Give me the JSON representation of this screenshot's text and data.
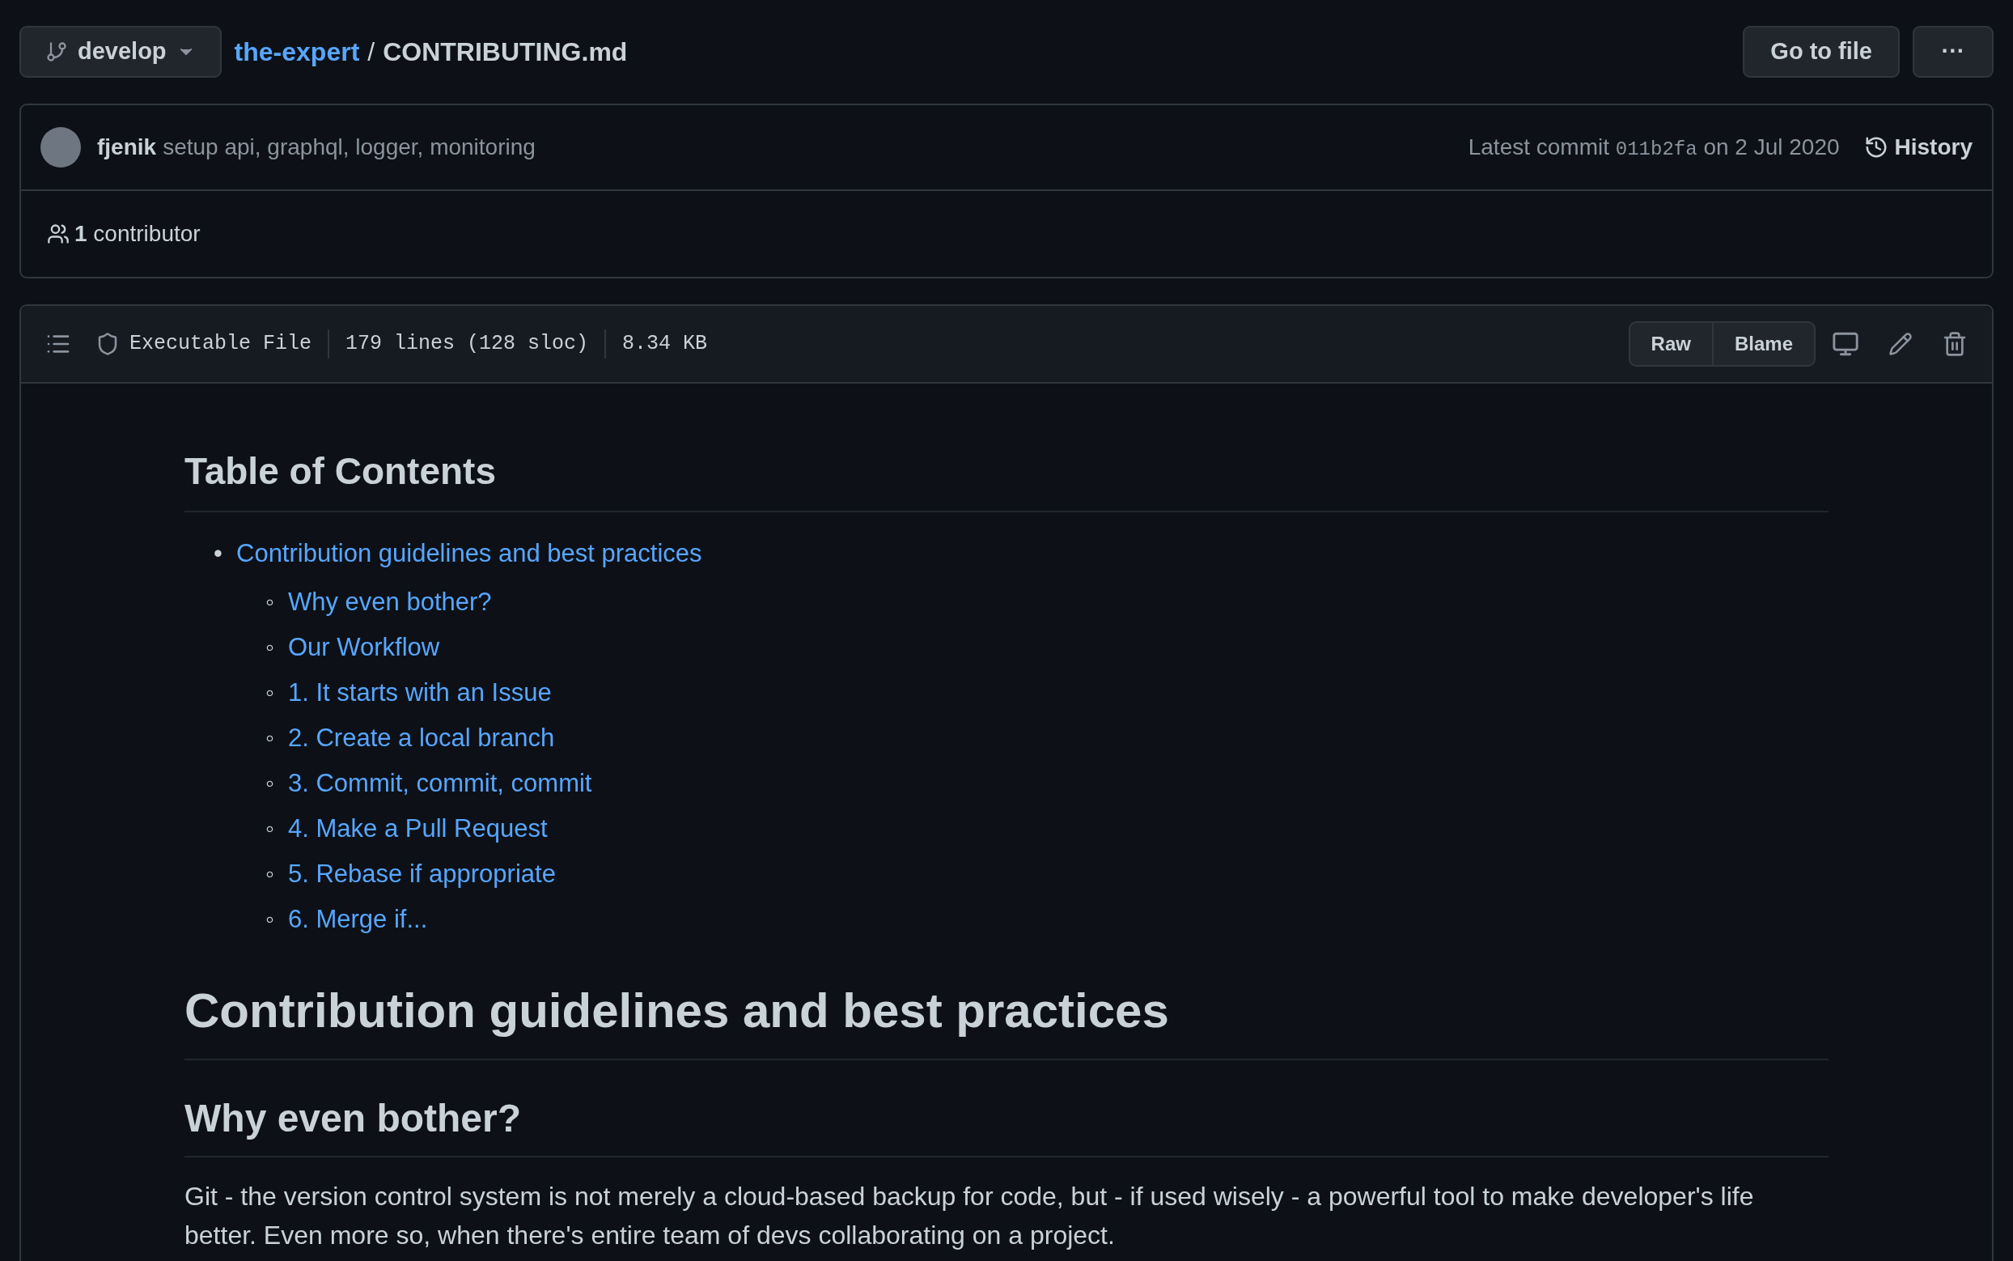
{
  "branch": {
    "name": "develop"
  },
  "breadcrumb": {
    "repo": "the-expert",
    "separator": "/",
    "file": "CONTRIBUTING.md"
  },
  "actions": {
    "go_to_file": "Go to file",
    "more": "···"
  },
  "commit": {
    "author": "fjenik",
    "message": "setup api, graphql, logger, monitoring",
    "prefix": "Latest commit",
    "sha": "011b2fa",
    "date": "on 2 Jul 2020",
    "history": "History"
  },
  "contributors": {
    "count": "1",
    "label": "contributor"
  },
  "file_header": {
    "type": "Executable File",
    "lines": "179 lines (128 sloc)",
    "size": "8.34 KB",
    "buttons": [
      "Raw",
      "Blame"
    ]
  },
  "content": {
    "toc_title": "Table of Contents",
    "toc": [
      {
        "marker": "•",
        "label": "Contribution guidelines and best practices",
        "children": [
          {
            "marker": "◦",
            "label": "Why even bother?"
          },
          {
            "marker": "◦",
            "label": "Our Workflow"
          },
          {
            "marker": "◦",
            "label": "1. It starts with an Issue"
          },
          {
            "marker": "◦",
            "label": "2. Create a local branch"
          },
          {
            "marker": "◦",
            "label": "3. Commit, commit, commit"
          },
          {
            "marker": "◦",
            "label": "4. Make a Pull Request"
          },
          {
            "marker": "◦",
            "label": "5. Rebase if appropriate"
          },
          {
            "marker": "◦",
            "label": "6. Merge if..."
          }
        ]
      }
    ],
    "h1": "Contribution guidelines and best practices",
    "h2": "Why even bother?",
    "paragraph": "Git - the version control system is not merely a cloud-based backup for code, but - if used wisely - a powerful tool to make developer's life better. Even more so, when there's entire team of devs collaborating on a project."
  }
}
